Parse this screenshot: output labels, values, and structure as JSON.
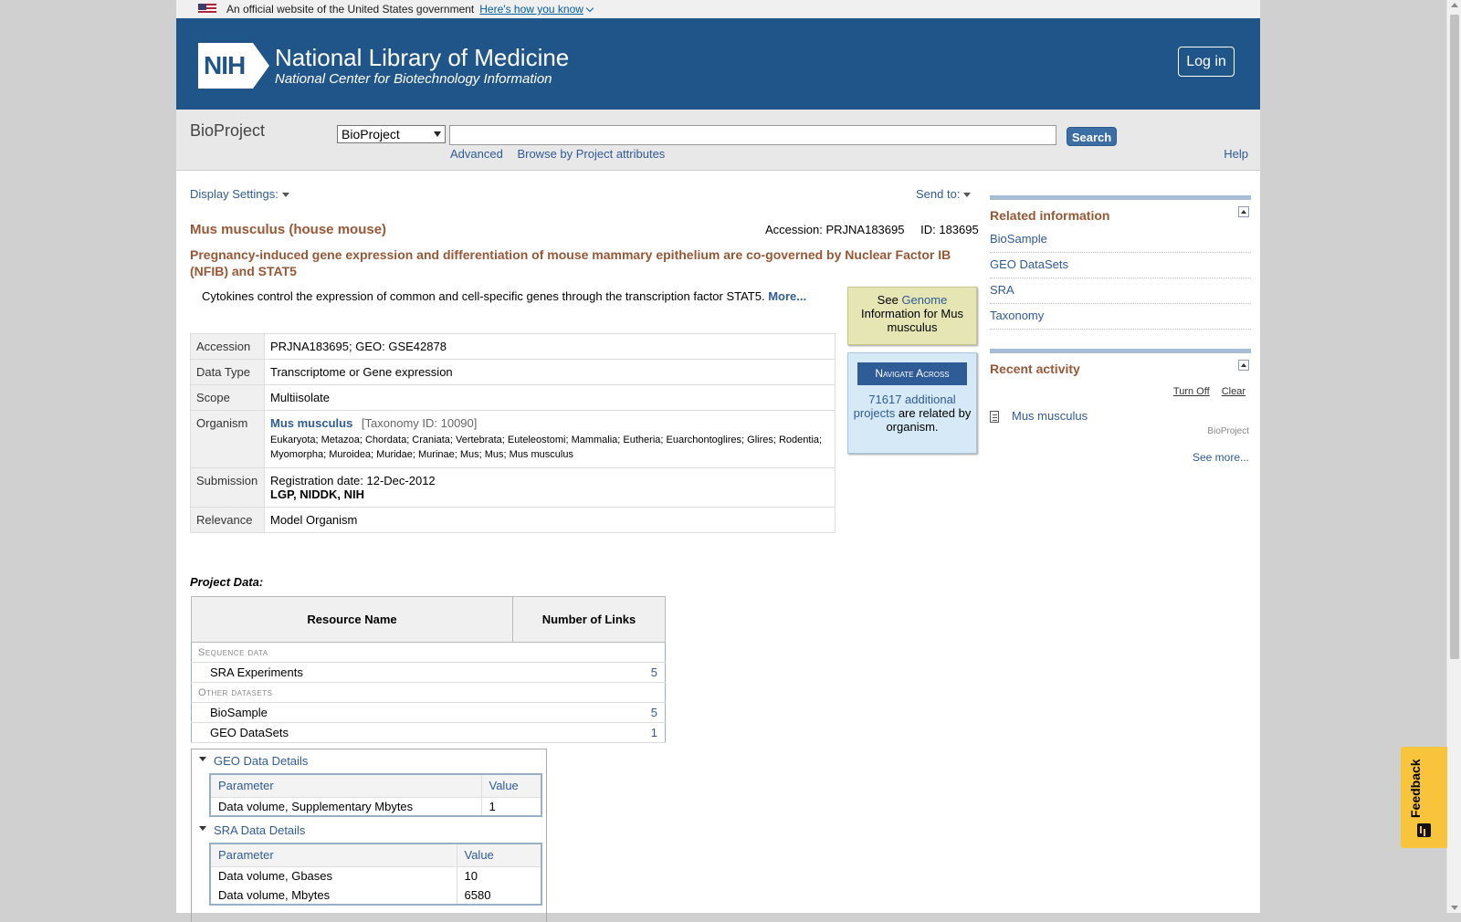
{
  "gov_banner": {
    "text": "An official website of the United States government",
    "link": "Here's how you know"
  },
  "header": {
    "title": "National Library of Medicine",
    "subtitle": "National Center for Biotechnology Information",
    "logo_text": "NIH",
    "login": "Log in"
  },
  "search": {
    "db_title": "BioProject",
    "db_selected": "BioProject",
    "term": "",
    "button": "Search",
    "advanced": "Advanced",
    "browse": "Browse by Project attributes",
    "help": "Help"
  },
  "toolbar": {
    "display_settings": "Display Settings:",
    "send_to": "Send to:"
  },
  "record": {
    "organism_title": "Mus musculus (house mouse)",
    "accession_line": "Accession: PRJNA183695",
    "id_line": "ID: 183695",
    "project_title": "Pregnancy-induced gene expression and differentiation of mouse mammary epithelium are co-governed by Nuclear Factor IB (NFIB) and STAT5",
    "description": "Cytokines control the expression of common and cell-specific genes through the transcription factor STAT5.",
    "more": "More..."
  },
  "attributes": {
    "accession": {
      "label": "Accession",
      "value": "PRJNA183695; GEO: GSE42878"
    },
    "data_type": {
      "label": "Data Type",
      "value": "Transcriptome or Gene expression"
    },
    "scope": {
      "label": "Scope",
      "value": "Multiisolate"
    },
    "organism": {
      "label": "Organism",
      "name": "Mus musculus",
      "taxonomy": "[Taxonomy ID: 10090]",
      "lineage": "Eukaryota; Metazoa; Chordata; Craniata; Vertebrata; Euteleostomi; Mammalia; Eutheria; Euarchontoglires; Glires; Rodentia; Myomorpha; Muroidea; Muridae; Murinae; Mus; Mus; Mus musculus"
    },
    "submission": {
      "label": "Submission",
      "date": "Registration date: 12-Dec-2012",
      "org": "LGP, NIDDK, NIH"
    },
    "relevance": {
      "label": "Relevance",
      "value": "Model Organism"
    }
  },
  "genome_box": {
    "see": "See",
    "link": "Genome",
    "rest": "Information for Mus musculus"
  },
  "nav_box": {
    "button": "Navigate Across",
    "link": "71617 additional projects",
    "rest": "are related by organism."
  },
  "project_data": {
    "title": "Project Data:",
    "col_name": "Resource Name",
    "col_links": "Number of Links",
    "sections": [
      {
        "label": "Sequence data",
        "rows": [
          {
            "name": "SRA Experiments",
            "count": "5"
          }
        ]
      },
      {
        "label": "Other datasets",
        "rows": [
          {
            "name": "BioSample",
            "count": "5"
          },
          {
            "name": "GEO DataSets",
            "count": "1"
          }
        ]
      }
    ]
  },
  "geo_details": {
    "title": "GEO Data Details",
    "col_param": "Parameter",
    "col_value": "Value",
    "rows": [
      {
        "param": "Data volume, Supplementary Mbytes",
        "value": "1"
      }
    ]
  },
  "sra_details": {
    "title": "SRA Data Details",
    "col_param": "Parameter",
    "col_value": "Value",
    "rows": [
      {
        "param": "Data volume, Gbases",
        "value": "10"
      },
      {
        "param": "Data volume, Mbytes",
        "value": "6580"
      }
    ]
  },
  "related": {
    "title": "Related information",
    "items": [
      "BioSample",
      "GEO DataSets",
      "SRA",
      "Taxonomy"
    ]
  },
  "recent": {
    "title": "Recent activity",
    "turn_off": "Turn Off",
    "clear": "Clear",
    "item": "Mus musculus",
    "item_db": "BioProject",
    "see_more": "See more..."
  },
  "feedback": {
    "label": "Feedback"
  }
}
